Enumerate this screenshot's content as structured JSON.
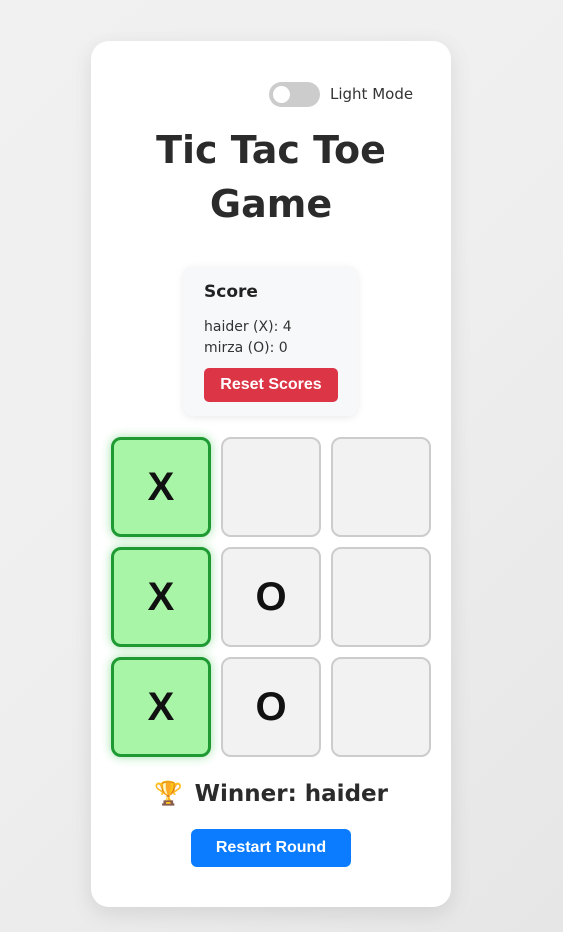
{
  "theme_toggle": {
    "label": "Light Mode"
  },
  "title_line1": "Tic Tac Toe",
  "title_line2": "Game",
  "score": {
    "heading": "Score",
    "player_x": "haider (X): 4",
    "player_o": "mirza (O): 0",
    "reset_label": "Reset Scores"
  },
  "board": {
    "cells": [
      "X",
      "",
      "",
      "X",
      "O",
      "",
      "X",
      "O",
      ""
    ],
    "winning_cells": [
      0,
      3,
      6
    ]
  },
  "status": {
    "trophy": "🏆",
    "text": "Winner: haider"
  },
  "restart_label": "Restart Round",
  "colors": {
    "reset_button": "#dc3545",
    "restart_button": "#0b7cff",
    "win_cell": "#a8f5a8",
    "win_border": "#1f9a32"
  }
}
